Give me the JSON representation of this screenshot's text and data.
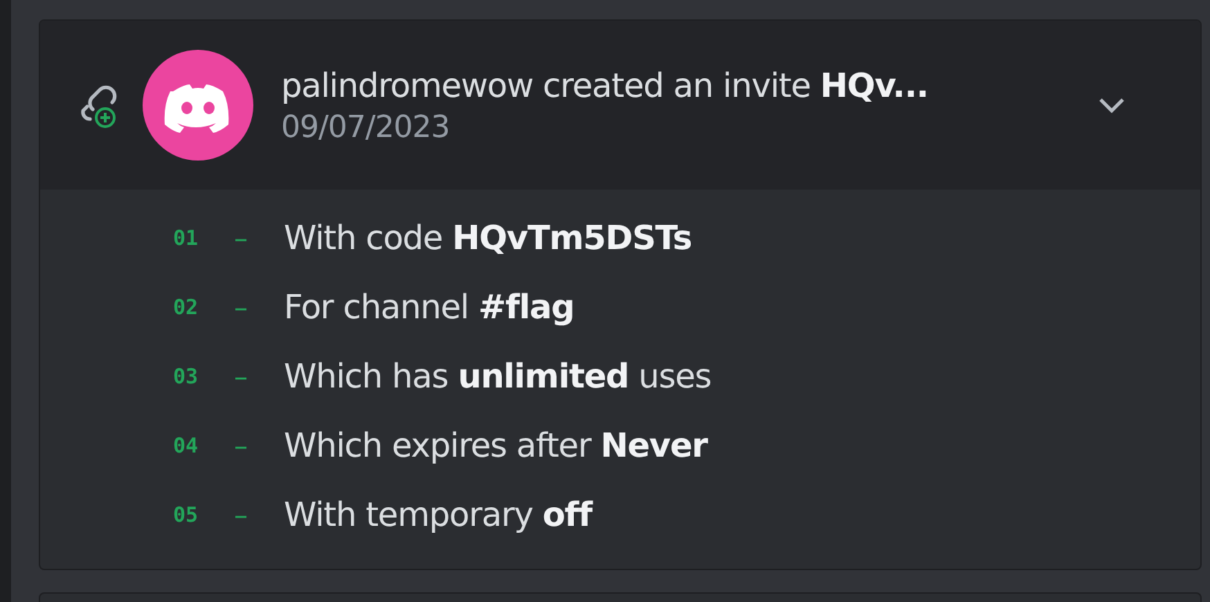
{
  "entry": {
    "title": "palindromewow created an invite **HQv...**",
    "date": "09/07/2023",
    "expanded": true,
    "details": [
      {
        "number": "01",
        "dash": "–",
        "text": "With code **HQvTm5DSTs**"
      },
      {
        "number": "02",
        "dash": "–",
        "text": "For channel **#flag**"
      },
      {
        "number": "03",
        "dash": "–",
        "text": "Which has **unlimited** uses"
      },
      {
        "number": "04",
        "dash": "–",
        "text": "Which expires after **Never**"
      },
      {
        "number": "05",
        "dash": "–",
        "text": "With temporary **off**"
      }
    ]
  }
}
